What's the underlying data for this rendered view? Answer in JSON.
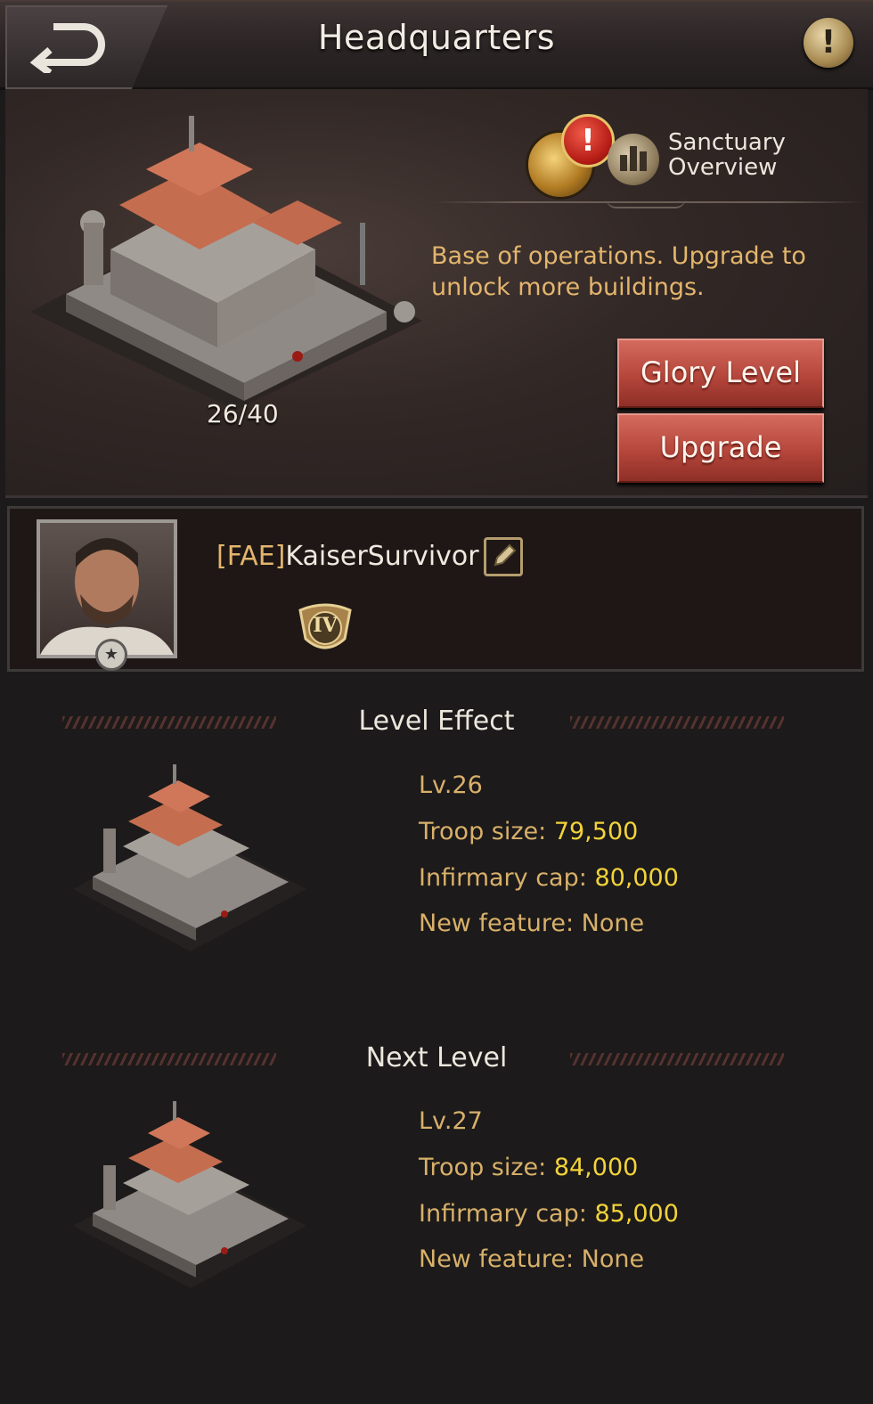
{
  "header": {
    "title": "Headquarters"
  },
  "hero": {
    "progress": "26/40",
    "sanctuary_label_line1": "Sanctuary",
    "sanctuary_label_line2": "Overview",
    "alert": "!",
    "description": "Base of operations. Upgrade to unlock more buildings.",
    "glory_button": "Glory Level",
    "upgrade_button": "Upgrade"
  },
  "player": {
    "alliance_tag": "[FAE]",
    "name": "KaiserSurvivor",
    "rank": "IV"
  },
  "level_effect": {
    "heading": "Level Effect",
    "level": "Lv.26",
    "troop_label": "Troop size: ",
    "troop_value": "79,500",
    "infirmary_label": "Infirmary cap: ",
    "infirmary_value": "80,000",
    "feature_label": "New feature: ",
    "feature_value": "None"
  },
  "next_level": {
    "heading": "Next Level",
    "level": "Lv.27",
    "troop_label": "Troop size: ",
    "troop_value": "84,000",
    "infirmary_label": "Infirmary cap: ",
    "infirmary_value": "85,000",
    "feature_label": "New feature: ",
    "feature_value": "None"
  }
}
